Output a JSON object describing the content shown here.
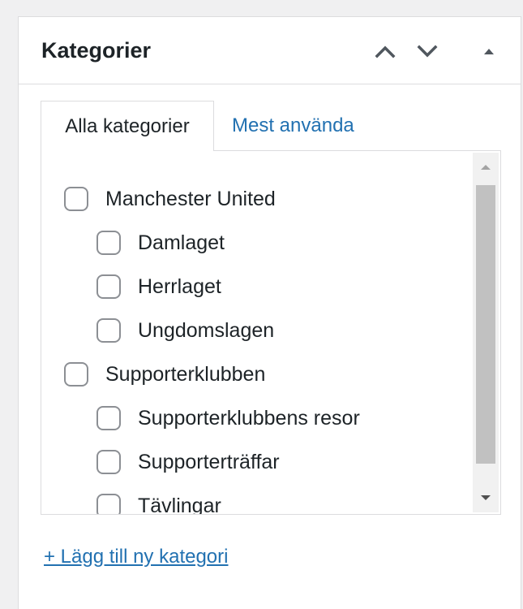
{
  "panel": {
    "title": "Kategorier",
    "controls": {
      "move_up": "chevron-up-icon",
      "move_down": "chevron-down-icon",
      "toggle": "triangle-up-icon"
    }
  },
  "tabs": {
    "active": "Alla kategorier",
    "other": "Mest använda"
  },
  "categories": [
    {
      "label": "Manchester United",
      "level": 0,
      "checked": false
    },
    {
      "label": "Damlaget",
      "level": 1,
      "checked": false
    },
    {
      "label": "Herrlaget",
      "level": 1,
      "checked": false
    },
    {
      "label": "Ungdomslagen",
      "level": 1,
      "checked": false
    },
    {
      "label": "Supporterklubben",
      "level": 0,
      "checked": false
    },
    {
      "label": "Supporterklubbens resor",
      "level": 1,
      "checked": false
    },
    {
      "label": "Supporterträffar",
      "level": 1,
      "checked": false
    },
    {
      "label": "Tävlingar",
      "level": 1,
      "checked": false
    }
  ],
  "add_link": "+ Lägg till ny kategori",
  "colors": {
    "link": "#2271b1",
    "text": "#1d2327",
    "border": "#dcdcde",
    "checkbox_border": "#8c8f94",
    "scroll_thumb": "#c1c1c1"
  }
}
